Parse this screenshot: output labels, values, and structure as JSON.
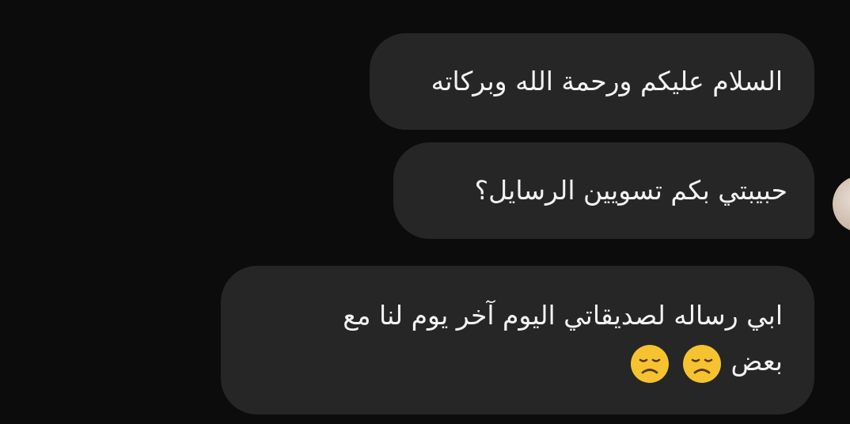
{
  "chat": {
    "messages": [
      {
        "text": "السلام عليكم ورحمة الله وبركاته"
      },
      {
        "text": "حبيبتي بكم تسويين الرسايل؟"
      },
      {
        "line1": "ابي رساله لصديقاتي اليوم آخر يوم لنا مع",
        "line2": "بعض",
        "emojis": [
          "disappointed-face",
          "disappointed-face"
        ]
      }
    ],
    "colors": {
      "background": "#0c0c0c",
      "bubble": "#262626",
      "text": "#f2f2f2",
      "emoji": "#f6c330"
    }
  }
}
